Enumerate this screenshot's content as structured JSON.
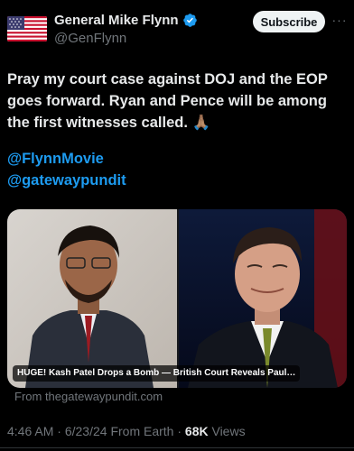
{
  "author": {
    "display_name": "General Mike Flynn",
    "handle": "@GenFlynn"
  },
  "actions": {
    "subscribe_label": "Subscribe",
    "more_label": "···"
  },
  "post": {
    "text": "Pray my court case against DOJ and the EOP goes forward. Ryan and Pence will be among the first witnesses called.",
    "emoji": "🙏🏽",
    "mentions": [
      "@FlynnMovie",
      "@gatewaypundit"
    ]
  },
  "link_card": {
    "title": "HUGE! Kash Patel Drops a Bomb — British Court Reveals Paul…",
    "source": "From thegatewaypundit.com"
  },
  "meta": {
    "time": "4:46 AM",
    "date": "6/23/24",
    "origin": "From Earth",
    "separator": "·",
    "views_count": "68K",
    "views_label": "Views"
  },
  "colors": {
    "background": "#000000",
    "text": "#e7e9ea",
    "muted": "#71767b",
    "link": "#1d9bf0",
    "verified": "#1d9bf0"
  },
  "icons": {
    "avatar": "american-flag-avatar",
    "verified": "verified-badge-icon",
    "more": "more-horizontal-icon"
  }
}
